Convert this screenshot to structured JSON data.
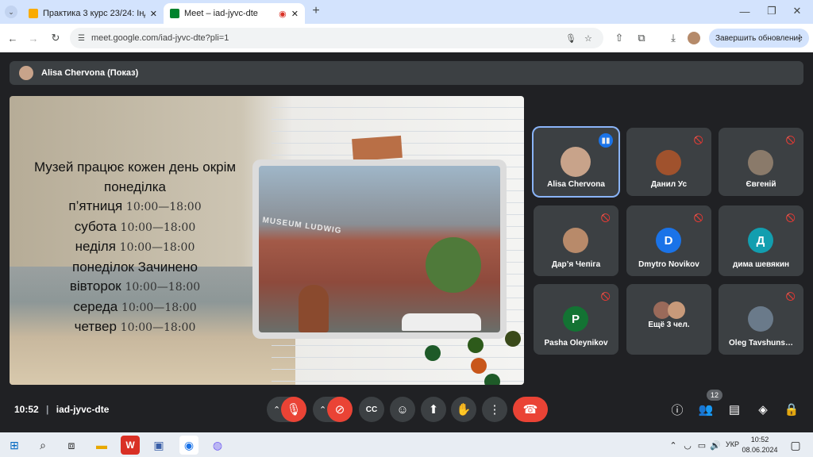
{
  "browser": {
    "tabs": [
      {
        "title": "Практика 3 курс 23/24: Індиві…",
        "icon": "classroom-icon",
        "color": "#f9ab00"
      },
      {
        "title": "Meet – iad-jyvc-dte",
        "icon": "meet-icon",
        "color": "#00832d"
      }
    ],
    "url": "meet.google.com/iad-jyvc-dte?pli=1",
    "update_label": "Завершить обновление"
  },
  "presenter": {
    "label": "Alisa Chervona (Показ)"
  },
  "slide": {
    "title_line1": "Музей працює кожен день окрім",
    "title_line2": "понеділка",
    "rows": [
      {
        "day": "п’ятниця",
        "time": "10:00—18:00"
      },
      {
        "day": "субота",
        "time": "10:00—18:00"
      },
      {
        "day": "неділя",
        "time": "10:00—18:00"
      },
      {
        "day": "понеділок",
        "time": "Зачинено"
      },
      {
        "day": "вівторок",
        "time": "10:00—18:00"
      },
      {
        "day": "середа",
        "time": "10:00—18:00"
      },
      {
        "day": "четвер",
        "time": "10:00—18:00"
      }
    ],
    "sign_text": "MUSEUM LUDWIG"
  },
  "participants": [
    {
      "name": "Alisa Chervona",
      "initial": "",
      "color": "#c8a38a",
      "speaking": true
    },
    {
      "name": "Данил Ус",
      "initial": "",
      "color": "#a0522d",
      "speaking": false
    },
    {
      "name": "Євгеній",
      "initial": "",
      "color": "#8a7a6a",
      "speaking": false
    },
    {
      "name": "Дар’я Чепіга",
      "initial": "",
      "color": "#b88a6a",
      "speaking": false
    },
    {
      "name": "Dmytro Novikov",
      "initial": "D",
      "color": "#1a73e8",
      "speaking": false
    },
    {
      "name": "дима шевякин",
      "initial": "Д",
      "color": "#129eaf",
      "speaking": false
    },
    {
      "name": "Pasha Oleynikov",
      "initial": "P",
      "color": "#137333",
      "speaking": false
    },
    {
      "name": "Ещё 3 чел.",
      "initial": "",
      "color": "#9a6a5a",
      "speaking": false
    },
    {
      "name": "Oleg Tavshuns…",
      "initial": "",
      "color": "#6a7a8a",
      "speaking": false
    }
  ],
  "meeting": {
    "time": "10:52",
    "code": "iad-jyvc-dte",
    "participant_count": "12"
  },
  "taskbar": {
    "lang": "УКР",
    "time": "10:52",
    "date": "08.06.2024"
  }
}
